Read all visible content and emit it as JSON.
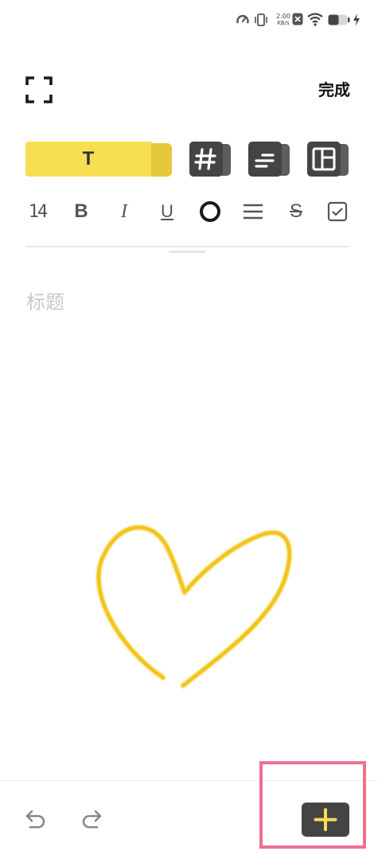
{
  "status_bar": {
    "net_speed_value": "2.00",
    "net_speed_unit": "KB/s",
    "icons": [
      "speedometer-icon",
      "vibrate-icon",
      "close-box-icon",
      "wifi-icon",
      "battery-icon",
      "charging-icon"
    ]
  },
  "header": {
    "expand_icon": "expand-icon",
    "done_label": "完成"
  },
  "mode_tabs": [
    {
      "id": "text",
      "label": "T",
      "active": true
    },
    {
      "id": "hash",
      "icon": "hash-icon",
      "active": false
    },
    {
      "id": "list",
      "icon": "align-icon",
      "active": false
    },
    {
      "id": "layout",
      "icon": "layout-icon",
      "active": false
    }
  ],
  "format_bar": {
    "font_size": "14",
    "bold": "B",
    "italic": "I",
    "underline": "U",
    "color_icon": "color-circle-icon",
    "list_icon": "list-lines-icon",
    "strike": "S",
    "checkbox_icon": "checkbox-icon"
  },
  "editor": {
    "title_placeholder": "标题"
  },
  "drawing": {
    "stroke_color": "#f2c41c",
    "shape": "heart"
  },
  "bottom_bar": {
    "undo_icon": "undo-icon",
    "redo_icon": "redo-icon",
    "add_icon": "plus-icon"
  },
  "colors": {
    "accent_yellow": "#f7df54",
    "add_button_bg": "#444444",
    "add_icon": "#f7df54",
    "highlight": "#f07090"
  }
}
